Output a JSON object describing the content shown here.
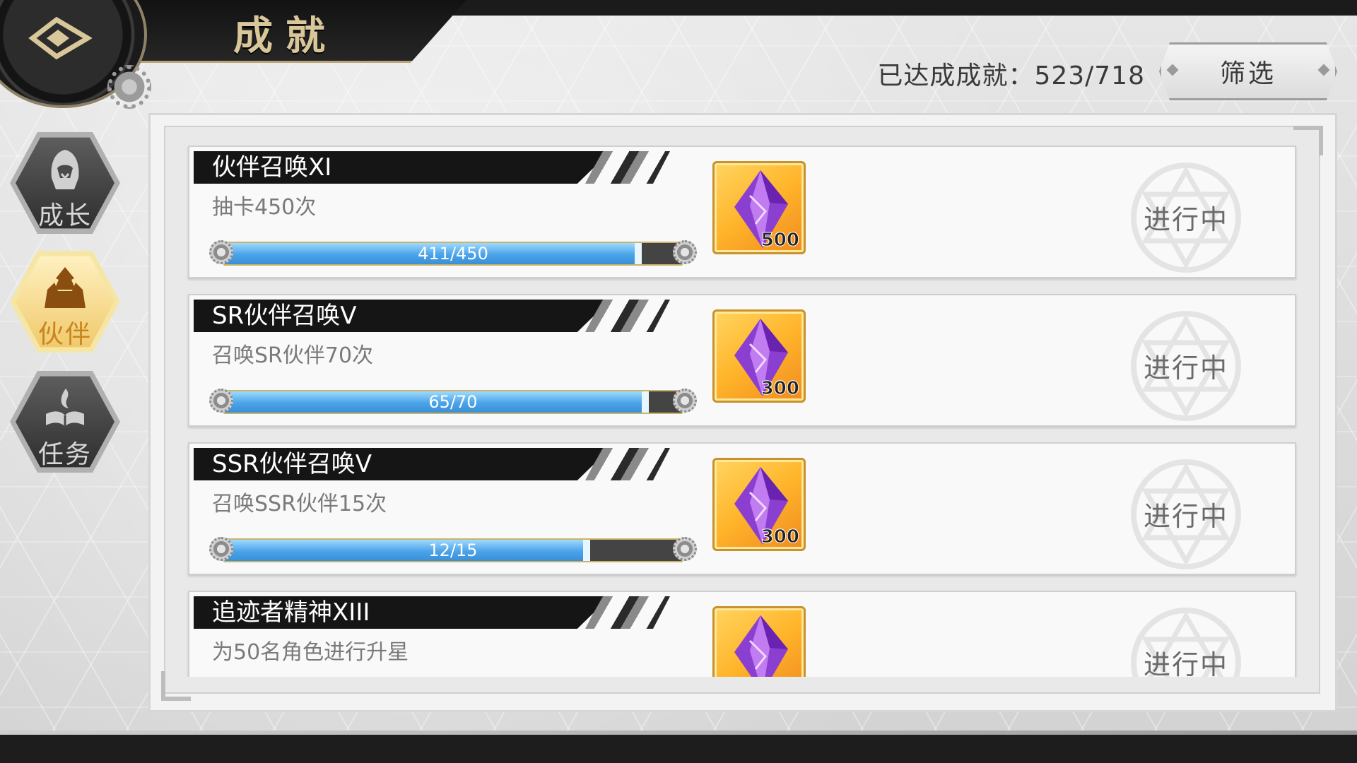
{
  "header": {
    "title": "成就",
    "achieved_label": "已达成成就：",
    "achieved_value": "523/718",
    "filter_label": "筛选"
  },
  "sidebar": {
    "tabs": [
      {
        "label": "成长",
        "icon": "hooded-figure-icon",
        "active": false
      },
      {
        "label": "伙伴",
        "icon": "party-figures-icon",
        "active": true
      },
      {
        "label": "任务",
        "icon": "flame-book-icon",
        "active": false
      }
    ]
  },
  "achievements": [
    {
      "title": "伙伴召唤XI",
      "desc": "抽卡450次",
      "progress_text": "411/450",
      "progress": 0.913,
      "reward_qty": "500",
      "reward_icon": "purple-crystal-icon",
      "status": "进行中"
    },
    {
      "title": "SR伙伴召唤V",
      "desc": "召唤SR伙伴70次",
      "progress_text": "65/70",
      "progress": 0.929,
      "reward_qty": "300",
      "reward_icon": "purple-crystal-icon",
      "status": "进行中"
    },
    {
      "title": "SSR伙伴召唤V",
      "desc": "召唤SSR伙伴15次",
      "progress_text": "12/15",
      "progress": 0.8,
      "reward_qty": "300",
      "reward_icon": "purple-crystal-icon",
      "status": "进行中"
    },
    {
      "title": "追迹者精神XIII",
      "desc": "为50名角色进行升星",
      "progress_text": "",
      "progress": null,
      "reward_qty": "",
      "reward_icon": "purple-crystal-icon",
      "status": "进行中"
    }
  ],
  "colors": {
    "accent_gold": "#d9c79a",
    "progress_blue": "#4aa3e8",
    "reward_orange": "#ffb42a",
    "active_tab": "#f0c96a"
  }
}
